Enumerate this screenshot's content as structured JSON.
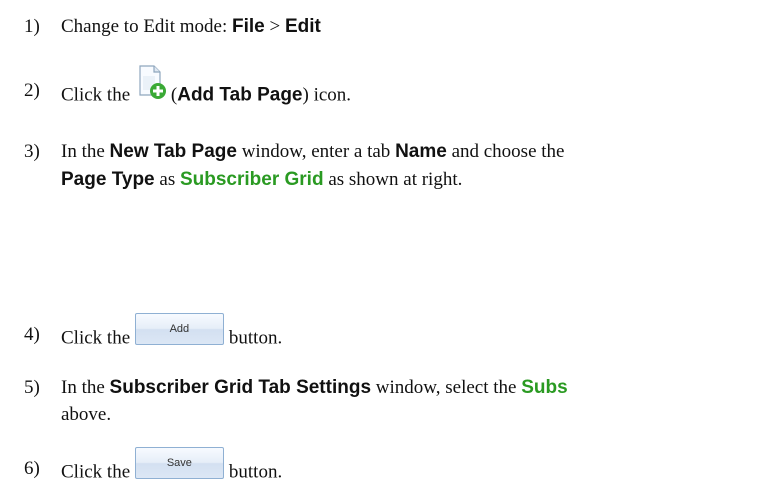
{
  "steps": [
    {
      "num": "1)",
      "pre": "Change to Edit mode:  ",
      "b1": "File",
      "mid": " > ",
      "b2": "Edit"
    },
    {
      "num": "2)",
      "pre": "Click the",
      "paren_open": "(",
      "bold": "Add Tab Page",
      "post": ") icon.",
      "icon": "add-page-icon"
    },
    {
      "num": "3)",
      "line1_pre": "In the ",
      "b1": "New Tab Page",
      "mid1": " window, enter a tab ",
      "b2": "Name",
      "mid2": " and choose the",
      "line2_b1": "Page Type",
      "line2_mid": " as ",
      "line2_green": "Subscriber Grid",
      "line2_post": " as shown at right."
    },
    {
      "num": "4)",
      "pre": "Click the",
      "button_label": "Add",
      "post": "button."
    },
    {
      "num": "5)",
      "line1_pre": "In the ",
      "b1": "Subscriber Grid Tab Settings",
      "mid1": " window, select the ",
      "green": "Subs",
      "line2": "above."
    },
    {
      "num": "6)",
      "pre": "Click the",
      "button_label": "Save",
      "post": "button."
    }
  ],
  "colors": {
    "accent_green": "#2a9a22",
    "button_border": "#8fb0d3"
  }
}
